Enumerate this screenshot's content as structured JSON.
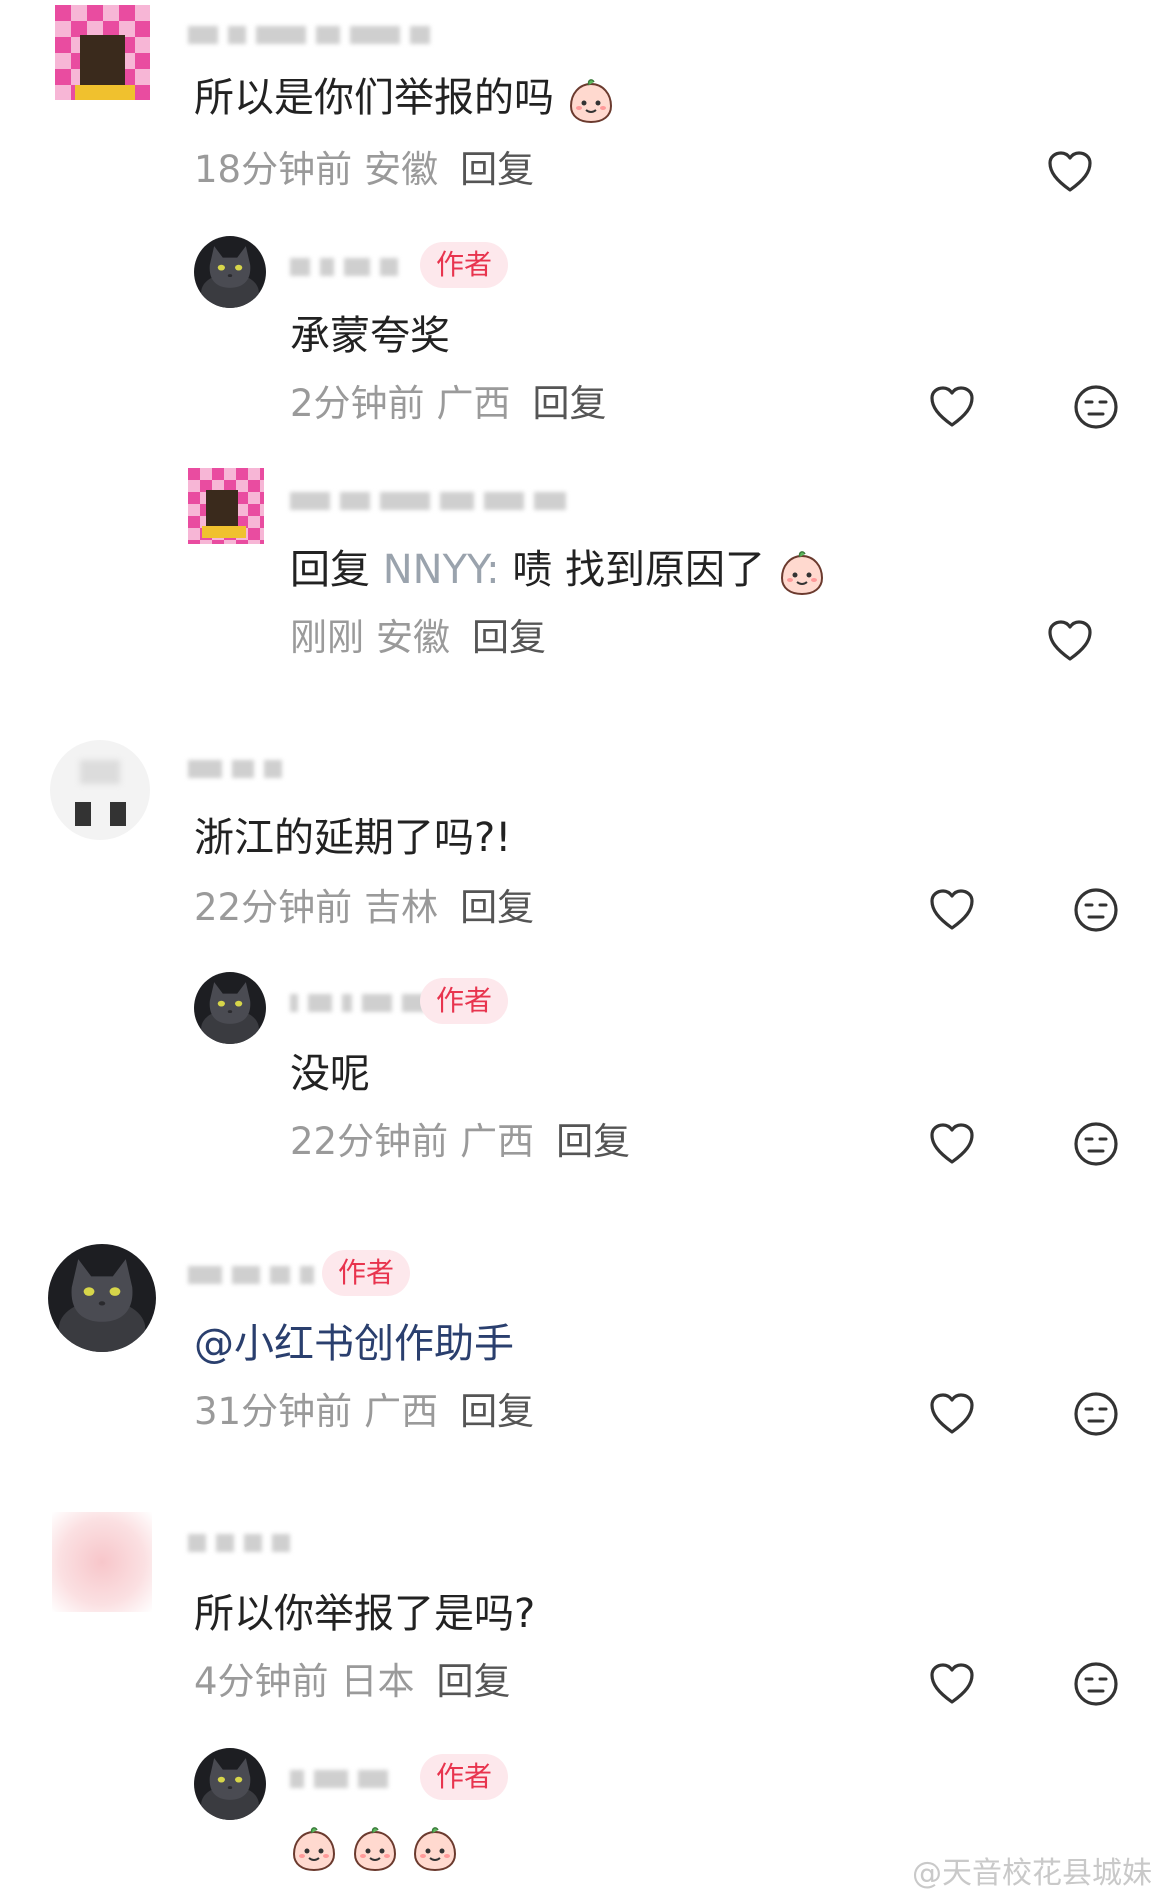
{
  "comments": [
    {
      "text": "所以是你们举报的吗",
      "time": "18分钟前",
      "location": "安徽",
      "reply": "回复"
    },
    {
      "author_badge": "作者",
      "text": "承蒙夸奖",
      "time": "2分钟前",
      "location": "广西",
      "reply": "回复"
    },
    {
      "text_prefix": "回复",
      "text_nick": "NNYY:",
      "text": "啧 找到原因了",
      "time": "刚刚",
      "location": "安徽",
      "reply": "回复"
    },
    {
      "text": "浙江的延期了吗?!",
      "time": "22分钟前",
      "location": "吉林",
      "reply": "回复"
    },
    {
      "author_badge": "作者",
      "text": "没呢",
      "time": "22分钟前",
      "location": "广西",
      "reply": "回复"
    },
    {
      "author_badge": "作者",
      "text": "@小红书创作助手",
      "time": "31分钟前",
      "location": "广西",
      "reply": "回复"
    },
    {
      "text": "所以你举报了是吗?",
      "time": "4分钟前",
      "location": "日本",
      "reply": "回复"
    },
    {
      "author_badge": "作者"
    }
  ],
  "icons": {
    "like": "heart-icon",
    "dislike": "neutral-face-icon",
    "emoji": "peach-emoji"
  },
  "watermark": "@天音校花县城妹",
  "colors": {
    "badge_bg": "#fde8ec",
    "badge_text": "#e8344e",
    "meta": "#9a9a9a",
    "text": "#222222"
  }
}
